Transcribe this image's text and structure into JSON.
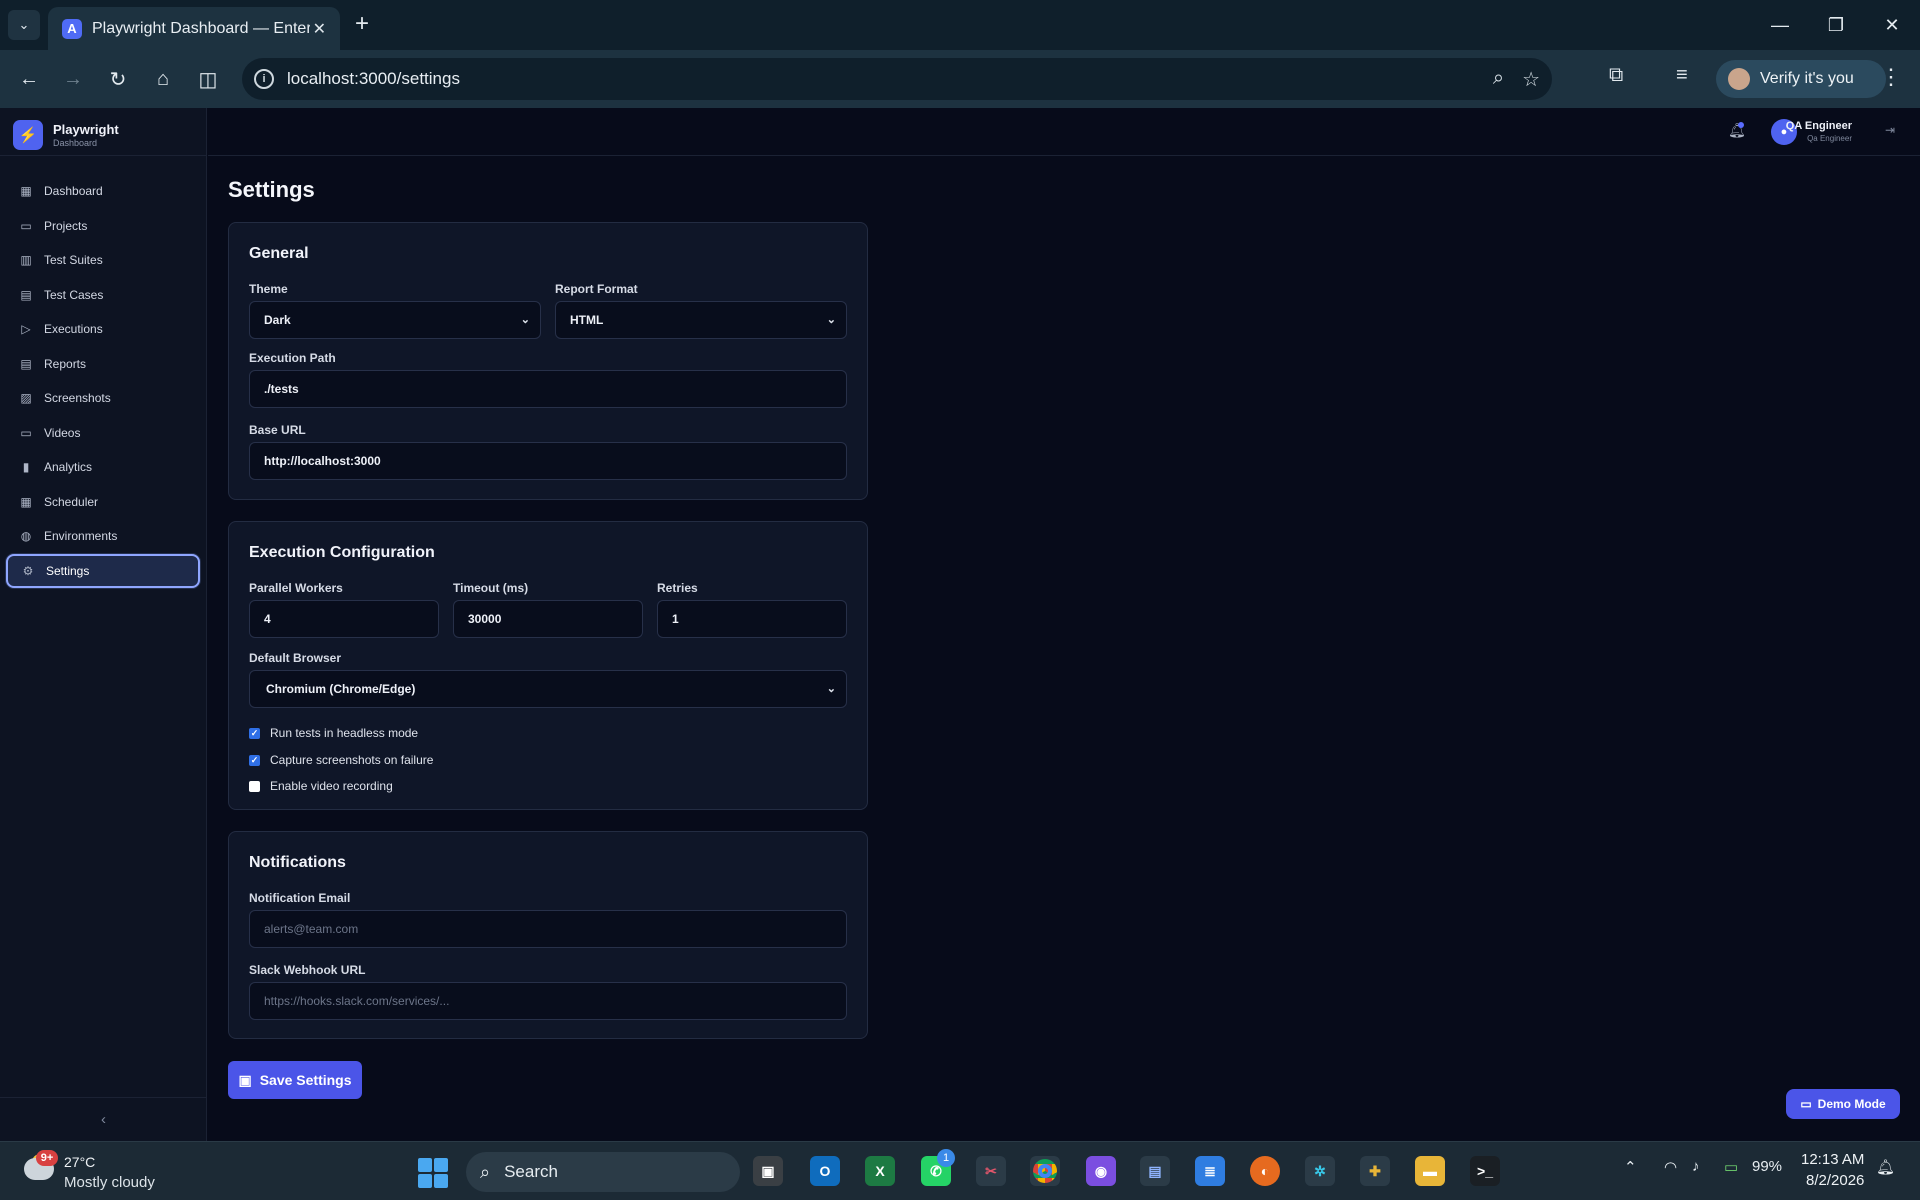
{
  "browser": {
    "tab_title": "Playwright Dashboard — Enterp",
    "tab_favicon_letter": "A",
    "url": "localhost:3000/settings",
    "verify_label": "Verify it's you"
  },
  "sidebar": {
    "brand_name": "Playwright",
    "brand_sub": "Dashboard",
    "items": [
      {
        "label": "Dashboard",
        "icon": "grid-icon"
      },
      {
        "label": "Projects",
        "icon": "folder-icon"
      },
      {
        "label": "Test Suites",
        "icon": "columns-icon"
      },
      {
        "label": "Test Cases",
        "icon": "file-icon"
      },
      {
        "label": "Executions",
        "icon": "play-icon"
      },
      {
        "label": "Reports",
        "icon": "report-icon"
      },
      {
        "label": "Screenshots",
        "icon": "image-icon"
      },
      {
        "label": "Videos",
        "icon": "video-icon"
      },
      {
        "label": "Analytics",
        "icon": "bar-chart-icon"
      },
      {
        "label": "Scheduler",
        "icon": "calendar-icon"
      },
      {
        "label": "Environments",
        "icon": "globe-icon"
      },
      {
        "label": "Settings",
        "icon": "gear-icon"
      }
    ]
  },
  "topbar": {
    "user_name": "QA Engineer",
    "user_role": "Qa Engineer"
  },
  "page": {
    "title": "Settings"
  },
  "general": {
    "heading": "General",
    "theme_label": "Theme",
    "theme_value": "Dark",
    "report_label": "Report Format",
    "report_value": "HTML",
    "exec_path_label": "Execution Path",
    "exec_path_value": "./tests",
    "base_url_label": "Base URL",
    "base_url_value": "http://localhost:3000"
  },
  "execution": {
    "heading": "Execution Configuration",
    "workers_label": "Parallel Workers",
    "workers_value": "4",
    "timeout_label": "Timeout (ms)",
    "timeout_value": "30000",
    "retries_label": "Retries",
    "retries_value": "1",
    "browser_label": "Default Browser",
    "browser_value": "Chromium (Chrome/Edge)",
    "checks": [
      {
        "label": "Run tests in headless mode",
        "checked": true
      },
      {
        "label": "Capture screenshots on failure",
        "checked": true
      },
      {
        "label": "Enable video recording",
        "checked": false
      }
    ]
  },
  "notifications": {
    "heading": "Notifications",
    "email_label": "Notification Email",
    "email_placeholder": "alerts@team.com",
    "slack_label": "Slack Webhook URL",
    "slack_placeholder": "https://hooks.slack.com/services/..."
  },
  "actions": {
    "save_label": "Save Settings",
    "demo_label": "Demo Mode"
  },
  "taskbar": {
    "weather_badge": "9+",
    "temperature": "27°C",
    "condition": "Mostly cloudy",
    "search_label": "Search",
    "whatsapp_badge": "1",
    "battery": "99%",
    "time": "12:13 AM",
    "date": "8/2/2026"
  }
}
